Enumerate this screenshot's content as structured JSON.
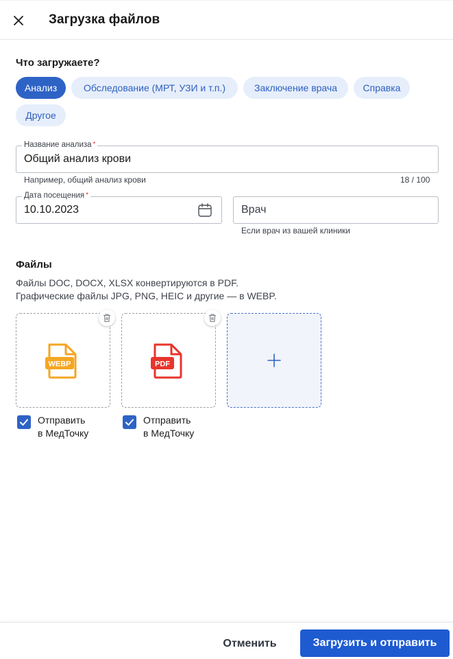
{
  "header": {
    "title": "Загрузка файлов",
    "close_icon": "close-icon"
  },
  "type_section": {
    "label": "Что загружаете?",
    "chips": [
      {
        "label": "Анализ",
        "active": true
      },
      {
        "label": "Обследование (МРТ, УЗИ и т.п.)",
        "active": false
      },
      {
        "label": "Заключение врача",
        "active": false
      },
      {
        "label": "Справка",
        "active": false
      },
      {
        "label": "Другое",
        "active": false
      }
    ]
  },
  "name_field": {
    "label": "Название анализа",
    "required_mark": "*",
    "value": "Общий анализ крови",
    "helper": "Например, общий анализ крови",
    "counter": "18 / 100"
  },
  "date_field": {
    "label": "Дата посещения",
    "required_mark": "*",
    "value": "10.10.2023",
    "icon": "calendar-icon"
  },
  "doctor_field": {
    "placeholder": "Врач",
    "helper": "Если врач из вашей клиники"
  },
  "files_section": {
    "label": "Файлы",
    "description_line1": "Файлы DOC, DOCX, XLSX конвертируются в PDF.",
    "description_line2": "Графические файлы JPG, PNG, HEIC и другие — в WEBP.",
    "files": [
      {
        "type_label": "WEBP",
        "color": "#f5a623",
        "checkbox_checked": true,
        "checkbox_line1": "Отправить",
        "checkbox_line2": "в МедТочку"
      },
      {
        "type_label": "PDF",
        "color": "#e8342b",
        "checkbox_checked": true,
        "checkbox_line1": "Отправить",
        "checkbox_line2": "в МедТочку"
      }
    ],
    "add_icon": "plus-icon"
  },
  "footer": {
    "cancel_label": "Отменить",
    "submit_label": "Загрузить и отправить"
  },
  "colors": {
    "accent": "#2e63c6",
    "primary_button": "#1e5bd1",
    "chip_bg": "#e6eefb",
    "required": "#e0363b"
  }
}
